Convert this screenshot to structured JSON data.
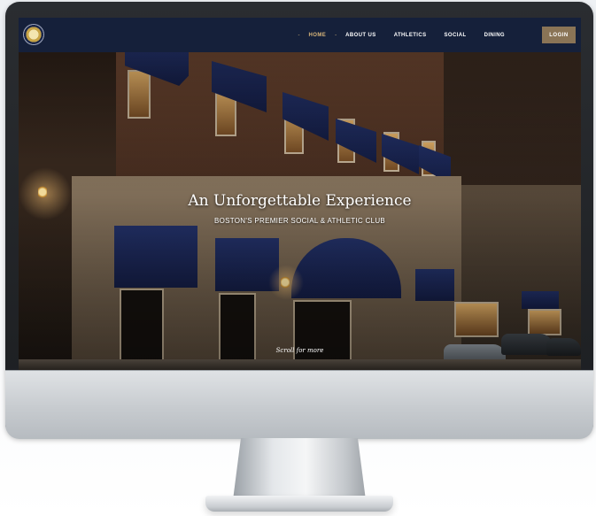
{
  "nav": {
    "items": [
      {
        "label": "HOME",
        "active": true
      },
      {
        "label": "ABOUT US",
        "active": false
      },
      {
        "label": "ATHLETICS",
        "active": false
      },
      {
        "label": "SOCIAL",
        "active": false
      },
      {
        "label": "DINING",
        "active": false
      }
    ],
    "login_label": "LOGIN",
    "logo_icon": "club-crest-icon"
  },
  "hero": {
    "headline": "An Unforgettable Experience",
    "subheadline": "BOSTON'S PREMIER SOCIAL & ATHLETIC CLUB",
    "scroll_hint": "Scroll for more"
  },
  "colors": {
    "nav_background": "#15203a",
    "accent_gold": "#d9b67a",
    "login_button": "#8a7456",
    "awning_navy": "#1c2756"
  }
}
